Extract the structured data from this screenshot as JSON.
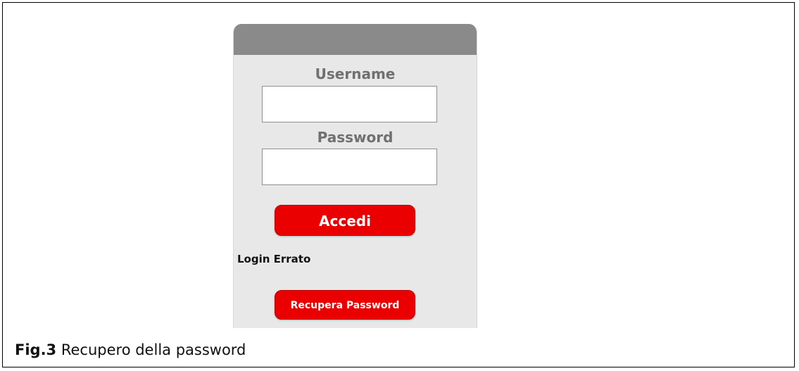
{
  "login": {
    "username_label": "Username",
    "username_value": "",
    "password_label": "Password",
    "password_value": "",
    "login_button_label": "Accedi",
    "error_message": "Login Errato",
    "recover_button_label": "Recupera Password"
  },
  "caption": {
    "label": "Fig.3",
    "text": "Recupero della password"
  },
  "colors": {
    "panel_background": "#e8e8e8",
    "panel_header": "#8a8a8a",
    "label_text": "#707070",
    "button_red": "#ea0000"
  }
}
